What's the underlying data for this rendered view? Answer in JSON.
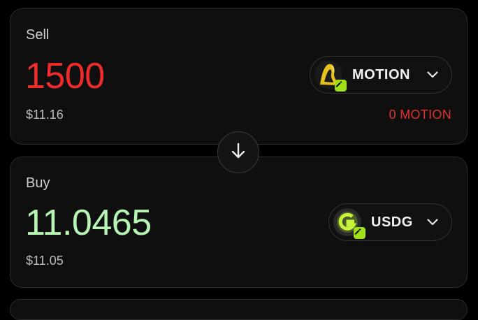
{
  "sell": {
    "label": "Sell",
    "amount": "1500",
    "usd_value": "$11.16",
    "balance": "0 MOTION",
    "token": {
      "symbol": "MOTION",
      "icon": "motion-token-icon",
      "chain_badge_icon": "chain-badge-icon"
    }
  },
  "buy": {
    "label": "Buy",
    "amount": "11.0465",
    "usd_value": "$11.05",
    "token": {
      "symbol": "USDG",
      "icon": "usdg-token-icon",
      "chain_badge_icon": "chain-badge-icon"
    }
  },
  "swap_direction_icon": "arrow-down-icon",
  "colors": {
    "sell_amount": "#ef2b2b",
    "buy_amount": "#b8f5b4",
    "balance_warning": "#e0332f",
    "chain_badge": "#9fe01a",
    "card_background": "#0f0f0f",
    "page_background": "#000000"
  }
}
